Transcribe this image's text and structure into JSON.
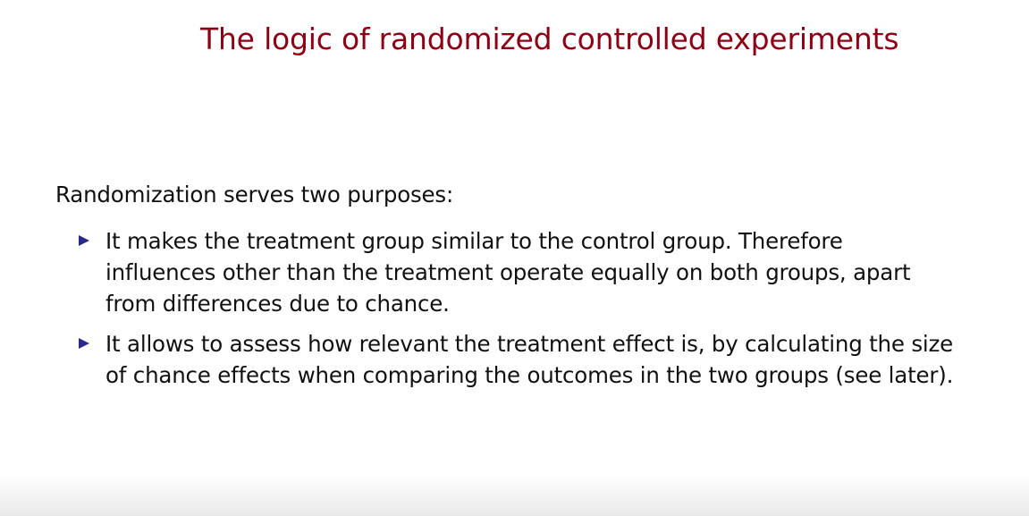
{
  "slide": {
    "title": "The logic of randomized controlled experiments",
    "intro": "Randomization serves two purposes:",
    "bullets": [
      {
        "text": "It makes the treatment group similar to the control group.  Therefore influences other than the treatment operate equally on both groups, apart from differences due to chance."
      },
      {
        "text": "It allows to assess how relevant the treatment effect is, by calculating the size of chance effects when comparing the outcomes in the two groups (see later)."
      }
    ]
  },
  "colors": {
    "title": "#8b0015",
    "body_text": "#111111",
    "bullet_marker": "#2a2a8c",
    "background": "#ffffff"
  },
  "icons": {
    "bullet_marker": "triangle-right-icon"
  }
}
